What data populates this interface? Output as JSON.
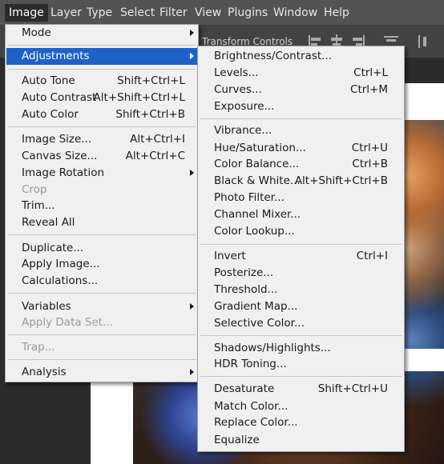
{
  "menubar": {
    "items": [
      "Image",
      "Layer",
      "Type",
      "Select",
      "Filter",
      "View",
      "Plugins",
      "Window",
      "Help"
    ]
  },
  "options_bar": {
    "transform_label": "Transform Controls"
  },
  "image_menu": {
    "items": [
      {
        "label": "Mode",
        "submenu": true
      },
      {
        "label": "Adjustments",
        "submenu": true,
        "highlighted": true
      },
      {
        "label": "Auto Tone",
        "shortcut": "Shift+Ctrl+L"
      },
      {
        "label": "Auto Contrast",
        "shortcut": "Alt+Shift+Ctrl+L"
      },
      {
        "label": "Auto Color",
        "shortcut": "Shift+Ctrl+B"
      },
      {
        "label": "Image Size...",
        "shortcut": "Alt+Ctrl+I"
      },
      {
        "label": "Canvas Size...",
        "shortcut": "Alt+Ctrl+C"
      },
      {
        "label": "Image Rotation",
        "submenu": true
      },
      {
        "label": "Crop",
        "disabled": true
      },
      {
        "label": "Trim..."
      },
      {
        "label": "Reveal All"
      },
      {
        "label": "Duplicate..."
      },
      {
        "label": "Apply Image..."
      },
      {
        "label": "Calculations..."
      },
      {
        "label": "Variables",
        "submenu": true
      },
      {
        "label": "Apply Data Set...",
        "disabled": true
      },
      {
        "label": "Trap...",
        "disabled": true
      },
      {
        "label": "Analysis",
        "submenu": true
      }
    ]
  },
  "adjustments_menu": {
    "items": [
      {
        "label": "Brightness/Contrast..."
      },
      {
        "label": "Levels...",
        "shortcut": "Ctrl+L"
      },
      {
        "label": "Curves...",
        "shortcut": "Ctrl+M"
      },
      {
        "label": "Exposure..."
      },
      {
        "label": "Vibrance..."
      },
      {
        "label": "Hue/Saturation...",
        "shortcut": "Ctrl+U"
      },
      {
        "label": "Color Balance...",
        "shortcut": "Ctrl+B"
      },
      {
        "label": "Black & White...",
        "shortcut": "Alt+Shift+Ctrl+B"
      },
      {
        "label": "Photo Filter..."
      },
      {
        "label": "Channel Mixer..."
      },
      {
        "label": "Color Lookup..."
      },
      {
        "label": "Invert",
        "shortcut": "Ctrl+I"
      },
      {
        "label": "Posterize..."
      },
      {
        "label": "Threshold..."
      },
      {
        "label": "Gradient Map..."
      },
      {
        "label": "Selective Color..."
      },
      {
        "label": "Shadows/Highlights..."
      },
      {
        "label": "HDR Toning..."
      },
      {
        "label": "Desaturate",
        "shortcut": "Shift+Ctrl+U"
      },
      {
        "label": "Match Color..."
      },
      {
        "label": "Replace Color..."
      },
      {
        "label": "Equalize"
      }
    ]
  },
  "colors": {
    "highlight": "#1e62c8",
    "menu_bg": "#f0f0f0",
    "menubar_bg": "#535353"
  }
}
